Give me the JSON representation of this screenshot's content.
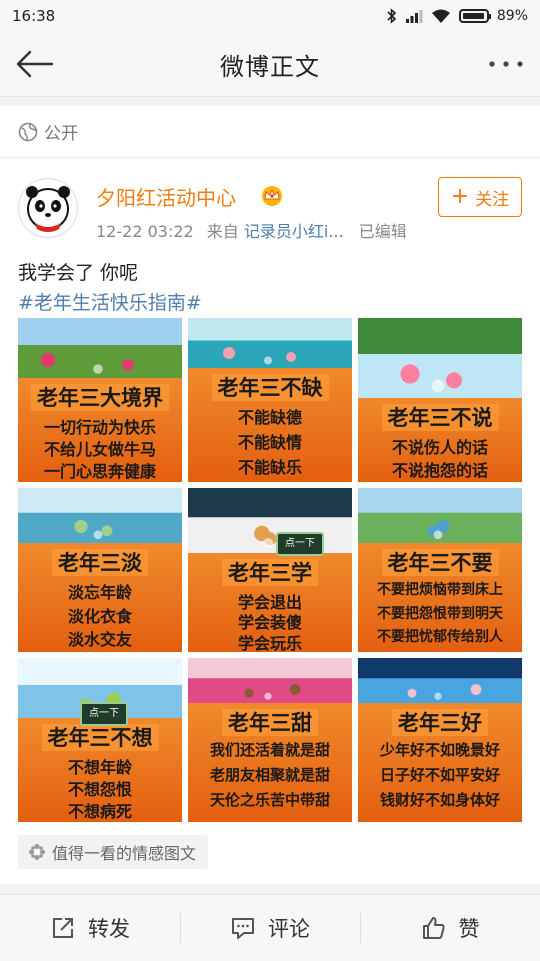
{
  "status_bar": {
    "time": "16:38",
    "battery": "89%"
  },
  "nav": {
    "title": "微博正文"
  },
  "visibility": {
    "label": "公开"
  },
  "post": {
    "username": "夕阳红活动中心",
    "timestamp": "12-22 03:22",
    "source_prefix": "来自",
    "source": "记录员小红i...",
    "edited": "已编辑",
    "follow_label": "关注",
    "text": "我学会了 你呢",
    "hashtag": "#老年生活快乐指南#",
    "tag_label": "值得一看的情感图文"
  },
  "images": [
    {
      "title": "老年三大境界",
      "lines": [
        "一切行动为快乐",
        "不给儿女做牛马",
        "一门心思奔健康"
      ]
    },
    {
      "title": "老年三不缺",
      "lines": [
        "不能缺德",
        "不能缺情",
        "不能缺乐"
      ]
    },
    {
      "title": "老年三不说",
      "lines": [
        "不说伤人的话",
        "不说抱怨的话"
      ]
    },
    {
      "title": "老年三淡",
      "lines": [
        "淡忘年龄",
        "淡化衣食",
        "淡水交友"
      ]
    },
    {
      "title": "老年三学",
      "lines": [
        "学会退出",
        "学会装傻",
        "学会玩乐"
      ],
      "badge": "点一下"
    },
    {
      "title": "老年三不要",
      "lines": [
        "不要把烦恼带到床上",
        "不要把怨恨带到明天",
        "不要把忧郁传给别人"
      ]
    },
    {
      "title": "老年三不想",
      "lines": [
        "不想年龄",
        "不想怨恨",
        "不想病死"
      ],
      "badge": "点一下"
    },
    {
      "title": "老年三甜",
      "lines": [
        "我们还活着就是甜",
        "老朋友相聚就是甜",
        "天伦之乐苦中带甜"
      ]
    },
    {
      "title": "老年三好",
      "lines": [
        "少年好不如晚景好",
        "日子好不如平安好",
        "钱财好不如身体好"
      ]
    }
  ],
  "actions": {
    "repost": "转发",
    "comment": "评论",
    "like": "赞"
  },
  "colors": {
    "accent": "#f07c0e",
    "link": "#507daf"
  }
}
